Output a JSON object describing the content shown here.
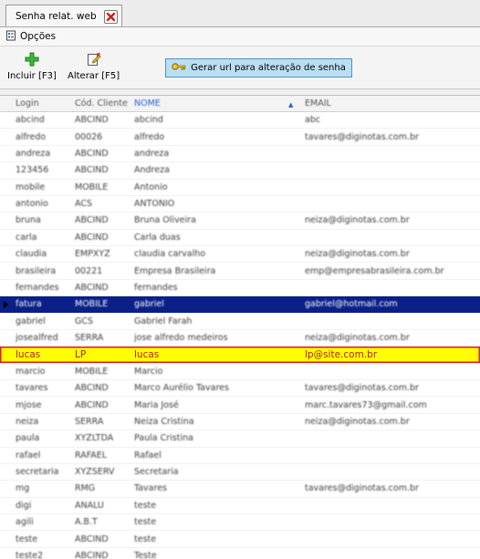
{
  "tab": {
    "title": "Senha relat. web"
  },
  "menu": {
    "options_label": "Opções"
  },
  "toolbar": {
    "include_label": "Incluir [F3]",
    "edit_label": "Alterar [F5]",
    "generate_url_label": "Gerar url para alteração de senha"
  },
  "grid": {
    "columns": {
      "login": "Login",
      "cod_cliente": "Cód. Cliente",
      "nome": "NOME",
      "email": "EMAIL"
    },
    "rows": [
      {
        "login": "abcind",
        "cod": "ABCIND",
        "nome": "abcind",
        "email": "abc"
      },
      {
        "login": "alfredo",
        "cod": "00026",
        "nome": "alfredo",
        "email": "tavares@diginotas.com.br"
      },
      {
        "login": "andreza",
        "cod": "ABCIND",
        "nome": "andreza",
        "email": ""
      },
      {
        "login": "123456",
        "cod": "ABCIND",
        "nome": "Andreza",
        "email": ""
      },
      {
        "login": "mobile",
        "cod": "MOBILE",
        "nome": "Antonio",
        "email": ""
      },
      {
        "login": "antonio",
        "cod": "ACS",
        "nome": "ANTONIO",
        "email": ""
      },
      {
        "login": "bruna",
        "cod": "ABCIND",
        "nome": "Bruna Oliveira",
        "email": "neiza@diginotas.com.br"
      },
      {
        "login": "carla",
        "cod": "ABCIND",
        "nome": "Carla duas",
        "email": ""
      },
      {
        "login": "claudia",
        "cod": "EMPXYZ",
        "nome": "claudia carvalho",
        "email": "neiza@diginotas.com.br"
      },
      {
        "login": "brasileira",
        "cod": "00221",
        "nome": "Empresa Brasileira",
        "email": "emp@empresabrasileira.com.br"
      },
      {
        "login": "fernandes",
        "cod": "ABCIND",
        "nome": "fernandes",
        "email": ""
      },
      {
        "login": "fatura",
        "cod": "MOBILE",
        "nome": "gabriel",
        "email": "gabriel@hotmail.com"
      },
      {
        "login": "gabriel",
        "cod": "GCS",
        "nome": "Gabriel Farah",
        "email": ""
      },
      {
        "login": "josealfred",
        "cod": "SERRA",
        "nome": "jose alfredo medeiros",
        "email": "neiza@diginotas.com.br"
      },
      {
        "login": "lucas",
        "cod": "LP",
        "nome": "lucas",
        "email": "lp@site.com.br"
      },
      {
        "login": "marcio",
        "cod": "MOBILE",
        "nome": "Marcio",
        "email": ""
      },
      {
        "login": "tavares",
        "cod": "ABCIND",
        "nome": "Marco Aurélio Tavares",
        "email": "tavares@diginotas.com.br"
      },
      {
        "login": "mjose",
        "cod": "ABCIND",
        "nome": "Maria José",
        "email": "marc.tavares73@gmail.com"
      },
      {
        "login": "neiza",
        "cod": "SERRA",
        "nome": "Neiza Cristina",
        "email": "neiza@diginotas.com.br"
      },
      {
        "login": "paula",
        "cod": "XYZLTDA",
        "nome": "Paula Cristina",
        "email": ""
      },
      {
        "login": "rafael",
        "cod": "RAFAEL",
        "nome": "Rafael",
        "email": ""
      },
      {
        "login": "secretaria",
        "cod": "XYZSERV",
        "nome": "Secretaria",
        "email": ""
      },
      {
        "login": "mg",
        "cod": "RMG",
        "nome": "Tavares",
        "email": "tavares@diginotas.com.br"
      },
      {
        "login": "digi",
        "cod": "ANALU",
        "nome": "teste",
        "email": ""
      },
      {
        "login": "agili",
        "cod": "A.B.T",
        "nome": "teste",
        "email": ""
      },
      {
        "login": "teste",
        "cod": "ABCIND",
        "nome": "teste",
        "email": ""
      },
      {
        "login": "teste2",
        "cod": "ABCIND",
        "nome": "Teste",
        "email": ""
      }
    ]
  }
}
